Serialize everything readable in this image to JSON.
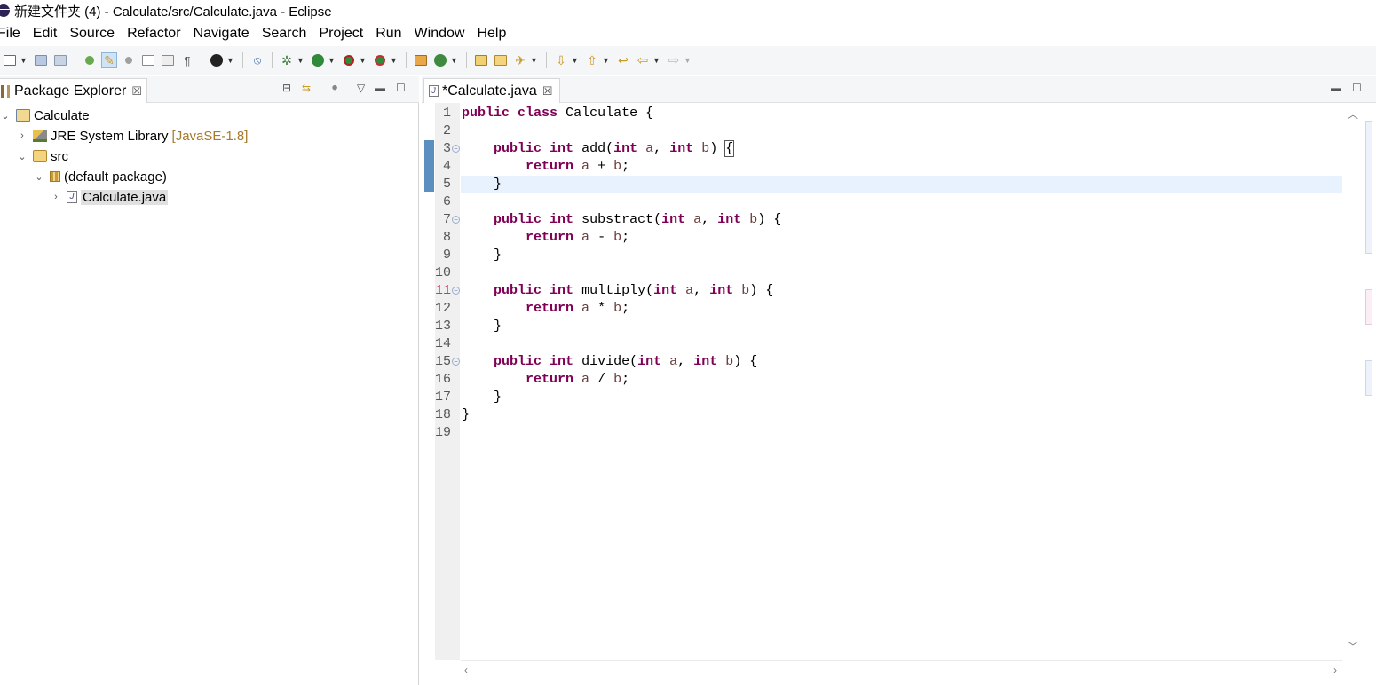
{
  "window": {
    "title": "新建文件夹 (4) - Calculate/src/Calculate.java - Eclipse"
  },
  "menu": [
    "File",
    "Edit",
    "Source",
    "Refactor",
    "Navigate",
    "Search",
    "Project",
    "Run",
    "Window",
    "Help"
  ],
  "package_explorer": {
    "tab_label": "Package Explorer",
    "close_glyph": "☒",
    "tree": [
      {
        "label": "Calculate",
        "decoration": "",
        "twisty": "⌄",
        "icon": "project-icon",
        "depth": 0
      },
      {
        "label": "JRE System Library",
        "decoration": "[JavaSE-1.8]",
        "twisty": "›",
        "icon": "library-icon",
        "depth": 1
      },
      {
        "label": "src",
        "decoration": "",
        "twisty": "⌄",
        "icon": "source-folder-icon",
        "depth": 1
      },
      {
        "label": "(default package)",
        "decoration": "",
        "twisty": "⌄",
        "icon": "package-icon",
        "depth": 2
      },
      {
        "label": "Calculate.java",
        "decoration": "",
        "twisty": "›",
        "icon": "java-file-icon",
        "depth": 3
      }
    ]
  },
  "editor": {
    "tab_label": "*Calculate.java",
    "file_glyph": "J",
    "current_line": 5,
    "lines": [
      "public class Calculate {",
      "",
      "\tpublic int add(int a, int b) {",
      "\t\treturn a + b;",
      "\t}",
      "",
      "\tpublic int substract(int a, int b) {",
      "\t\treturn a - b;",
      "\t}",
      "",
      "\tpublic int multiply(int a, int b) {",
      "\t\treturn a * b;",
      "\t}",
      "",
      "\tpublic int divide(int a, int b) {",
      "\t\treturn a / b;",
      "\t}",
      "}",
      ""
    ],
    "fold_lines": [
      3,
      7,
      11,
      15
    ],
    "warning_lines": [
      11
    ]
  },
  "colors": {
    "keyword": "#7f0055",
    "variable": "#6a3e3e",
    "current_line": "#e8f2fe",
    "change_marker": "#5b8fbf"
  }
}
